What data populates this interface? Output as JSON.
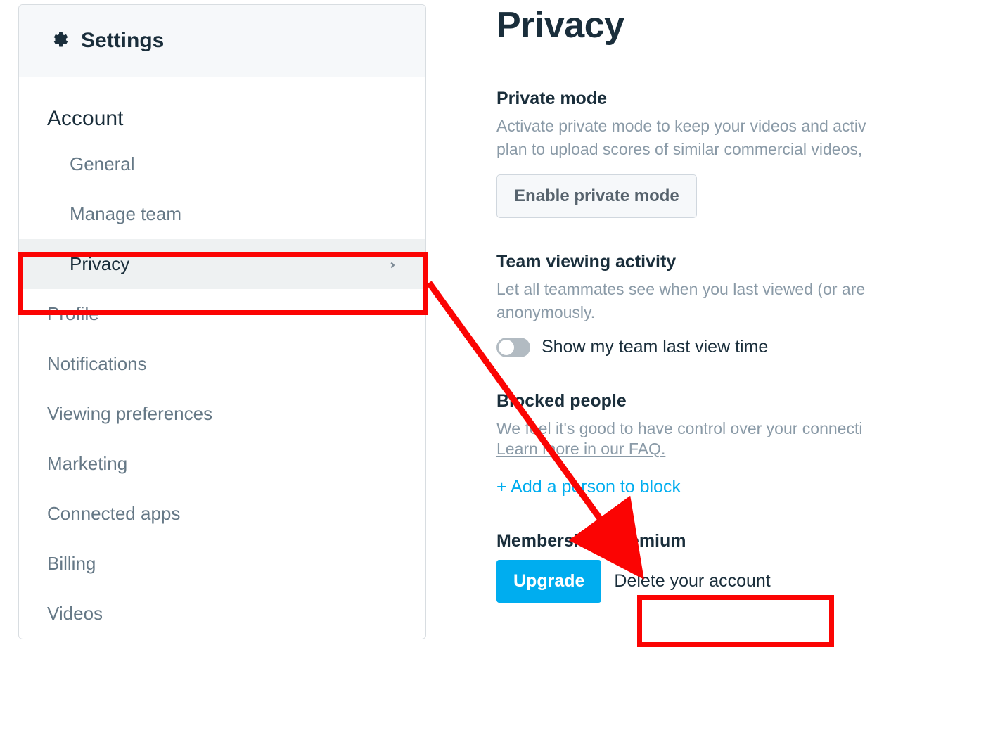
{
  "sidebar": {
    "title": "Settings",
    "account_heading": "Account",
    "items": [
      {
        "label": "General",
        "active": false
      },
      {
        "label": "Manage team",
        "active": false
      },
      {
        "label": "Privacy",
        "active": true
      }
    ],
    "top_items": [
      {
        "label": "Profile"
      },
      {
        "label": "Notifications"
      },
      {
        "label": "Viewing preferences"
      },
      {
        "label": "Marketing"
      },
      {
        "label": "Connected apps"
      },
      {
        "label": "Billing"
      },
      {
        "label": "Videos"
      }
    ]
  },
  "content": {
    "title": "Privacy",
    "private_mode": {
      "heading": "Private mode",
      "desc1": "Activate private mode to keep your videos and activ",
      "desc2": "plan to upload scores of similar commercial videos,",
      "button": "Enable private mode"
    },
    "team_activity": {
      "heading": "Team viewing activity",
      "desc1": "Let all teammates see when you last viewed (or are",
      "desc2": "anonymously.",
      "toggle_label": "Show my team last view time",
      "toggle_on": false
    },
    "blocked": {
      "heading": "Blocked people",
      "desc": "We feel it's good to have control over your connecti",
      "faq": "Learn more in our FAQ.",
      "add": "+ Add a person to block"
    },
    "membership": {
      "heading": "Membership: Premium",
      "upgrade": "Upgrade",
      "delete": "Delete your account"
    }
  },
  "annotations": {
    "highlight_color": "#fb0403"
  }
}
